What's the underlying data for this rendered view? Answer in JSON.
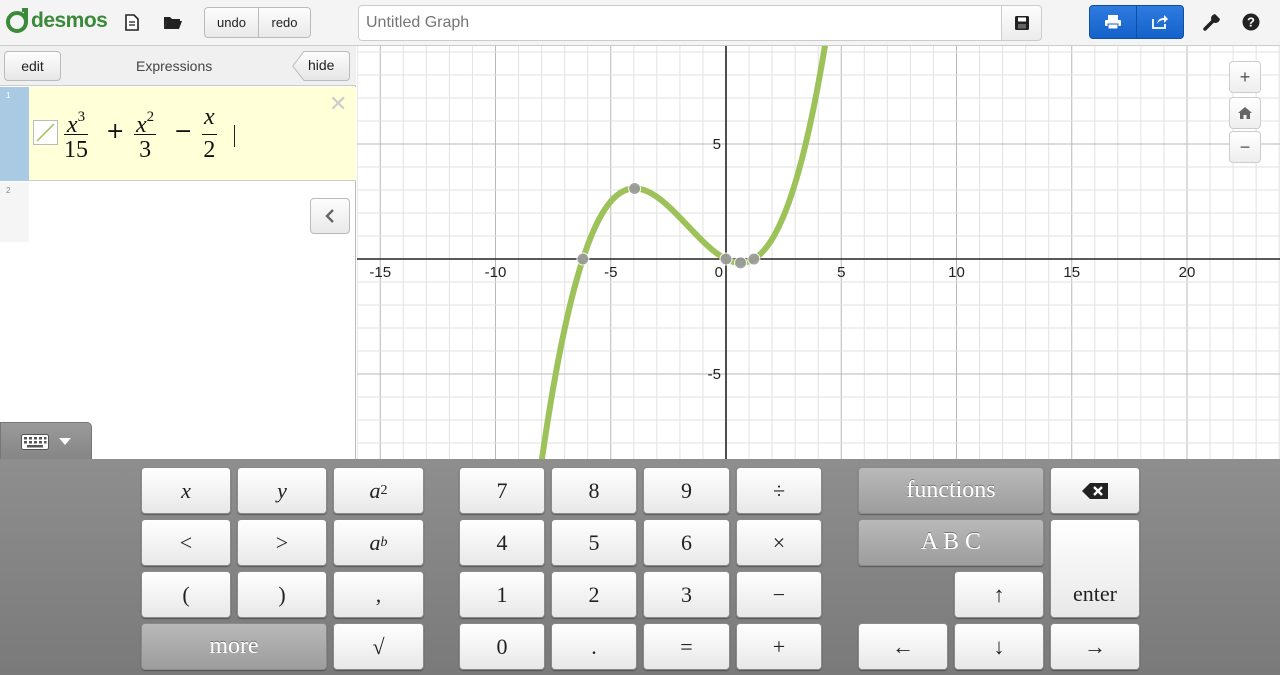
{
  "app": {
    "logo_text": "desmos",
    "brand_color": "#3a8a3a",
    "accent_color": "#1a6ad6"
  },
  "toolbar": {
    "new_icon": "document-icon",
    "open_icon": "folder-icon",
    "undo_label": "undo",
    "redo_label": "redo",
    "title_placeholder": "Untitled Graph",
    "title_value": "",
    "save_icon": "floppy-icon",
    "print_icon": "print-icon",
    "share_icon": "share-icon",
    "settings_icon": "wrench-icon",
    "help_icon": "question-icon"
  },
  "expressions": {
    "edit_label": "edit",
    "title": "Expressions",
    "hide_label": "hide",
    "rows": [
      {
        "index": "1",
        "latex_parts": {
          "num1": "x",
          "pow1": "3",
          "den1": "15",
          "op1": "+",
          "num2": "x",
          "pow2": "2",
          "den2": "3",
          "op2": "−",
          "num3": "x",
          "den3": "2"
        },
        "color": "#8fb34a"
      },
      {
        "index": "2"
      }
    ],
    "close_glyph": "✕",
    "collapse_icon": "chevron-left-icon"
  },
  "graph": {
    "x_range": [
      -16,
      24
    ],
    "y_range": [
      -9,
      9
    ],
    "x_tick_labels": [
      "-15",
      "-10",
      "-5",
      "0",
      "5",
      "10",
      "15",
      "20"
    ],
    "y_tick_labels": [
      "5",
      "-5"
    ],
    "grid": true,
    "curve_color": "#9ec25a",
    "point_color": "#9a9a9a",
    "zoom_in": "+",
    "home_icon": "home-icon",
    "zoom_out": "−"
  },
  "keypad": {
    "toggle_icon": "keyboard-icon",
    "keys": {
      "x": "x",
      "y": "y",
      "a": "a",
      "sq": "2",
      "b": "b",
      "lt": "<",
      "gt": ">",
      "lp": "(",
      "rp": ")",
      "comma": ",",
      "more": "more",
      "sqrt": "√",
      "k7": "7",
      "k8": "8",
      "k9": "9",
      "div": "÷",
      "k4": "4",
      "k5": "5",
      "k6": "6",
      "mul": "×",
      "k1": "1",
      "k2": "2",
      "k3": "3",
      "minus": "−",
      "k0": "0",
      "dot": ".",
      "eq": "=",
      "plus": "+",
      "functions": "functions",
      "abc": "A B C",
      "enter": "enter",
      "up": "↑",
      "down": "↓",
      "left": "←",
      "right": "→"
    },
    "backspace_icon": "backspace-icon"
  }
}
